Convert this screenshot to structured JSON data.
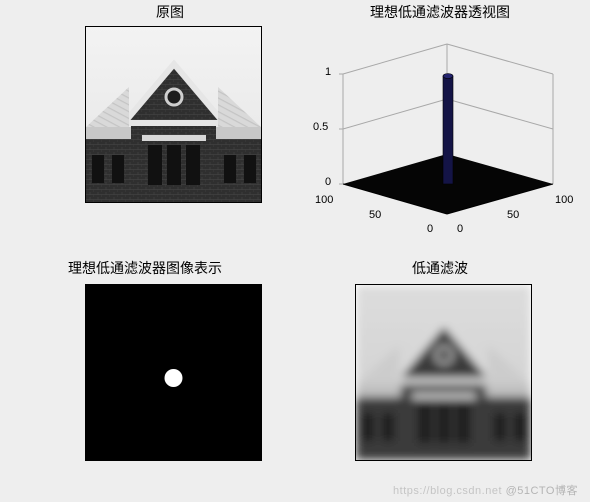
{
  "titles": {
    "p1": "原图",
    "p2": "理想低通滤波器透视图",
    "p3": "理想低通滤波器图像表示",
    "p4": "低通滤波"
  },
  "watermark": {
    "a": "https://blog.csdn.net",
    "b": "@51CTO博客"
  },
  "chart_data": [
    {
      "type": "other",
      "role": "image",
      "title": "原图",
      "desc": "grayscale photo of brick building with triangular gable roof"
    },
    {
      "type": "other",
      "role": "surface3d",
      "title": "理想低通滤波器透视图",
      "xlim": [
        0,
        100
      ],
      "ylim": [
        0,
        100
      ],
      "zlim": [
        0,
        1
      ],
      "x_ticks": [
        0,
        50,
        100
      ],
      "y_ticks": [
        0,
        50,
        100
      ],
      "z_ticks": [
        0,
        0.5,
        1
      ],
      "filter": {
        "shape": "ideal_lowpass",
        "radius": 5,
        "value_in": 1,
        "value_out": 0,
        "center": [
          50,
          50
        ]
      },
      "desc": "3D perspective of ideal low-pass filter: flat zero plane with a narrow cylinder of height 1 at center"
    },
    {
      "type": "heatmap",
      "title": "理想低通滤波器图像表示",
      "size": [
        100,
        100
      ],
      "pass_value": 1,
      "stop_value": 0,
      "center": [
        50,
        50
      ],
      "radius": 5,
      "desc": "binary mask image: black field with small white disk at center"
    },
    {
      "type": "other",
      "role": "image",
      "title": "低通滤波",
      "desc": "blurred low-pass-filtered version of original image"
    }
  ],
  "ticks3d": {
    "z": [
      "1",
      "0.5",
      "0"
    ],
    "left": [
      "100",
      "50",
      "0"
    ],
    "front": [
      "0",
      "50",
      "100"
    ]
  }
}
